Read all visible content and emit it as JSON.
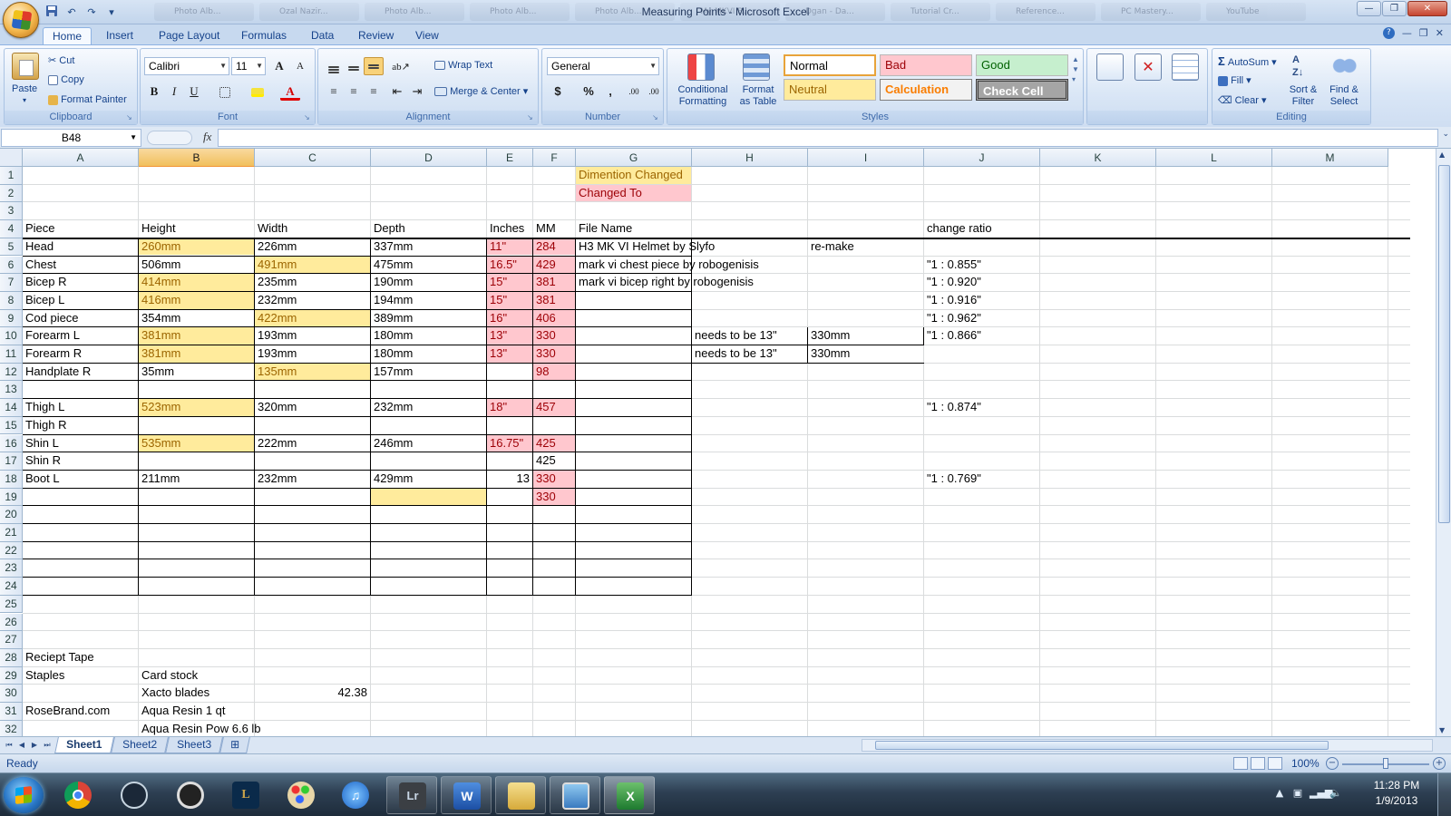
{
  "window": {
    "title": "Measuring Points - Microsoft Excel",
    "background_tabs": [
      "Photo Alb...",
      "Ozal Nazir...",
      "Photo Alb...",
      "Photo Alb...",
      "Photo Alb...",
      "My MKVI P...",
      "Dgan - Da...",
      "Tutorial Cr...",
      "Reference...",
      "PC Mastery...",
      "YouTube"
    ]
  },
  "qat": {
    "save": "save-icon",
    "undo": "undo-icon",
    "redo": "redo-icon"
  },
  "ribbon_tabs": [
    "Home",
    "Insert",
    "Page Layout",
    "Formulas",
    "Data",
    "Review",
    "View"
  ],
  "active_tab": "Home",
  "clipboard": {
    "paste": "Paste",
    "cut": "Cut",
    "copy": "Copy",
    "format_painter": "Format Painter",
    "label": "Clipboard"
  },
  "font": {
    "name": "Calibri",
    "size": "11",
    "grow": "A",
    "shrink": "A",
    "bold": "B",
    "italic": "I",
    "underline": "U",
    "label": "Font",
    "font_color": "A"
  },
  "alignment": {
    "wrap": "Wrap Text",
    "merge": "Merge & Center",
    "label": "Alignment"
  },
  "number": {
    "format": "General",
    "currency": "$",
    "percent": "%",
    "comma": ",",
    "inc_dec": ".00",
    "label": "Number"
  },
  "styles": {
    "conditional": "Conditional Formatting",
    "format_table": "Format as Table",
    "normal": "Normal",
    "bad": "Bad",
    "good": "Good",
    "neutral": "Neutral",
    "calculation": "Calculation",
    "check_cell": "Check Cell",
    "label": "Styles"
  },
  "cells": {
    "G1": "Dimention Changed",
    "G2": "Changed To",
    "A4": "Piece",
    "B4": "Height",
    "C4": "Width",
    "D4": "Depth",
    "E4": "Inches",
    "F4": "MM",
    "G4": "File Name",
    "J4": "change ratio",
    "A5": "Head",
    "B5": "260mm",
    "C5": "226mm",
    "D5": "337mm",
    "E5": "11\"",
    "F5": "284",
    "G5": "H3 MK VI Helmet by Slyfo",
    "I5": "re-make",
    "A6": "Chest",
    "B6": "506mm",
    "C6": "491mm",
    "D6": "475mm",
    "E6": "16.5\"",
    "F6": "429",
    "G6": "mark vi chest piece by robogenisis",
    "J6": "\"1 : 0.855\"",
    "A7": "Bicep R",
    "B7": "414mm",
    "C7": "235mm",
    "D7": "190mm",
    "E7": "15\"",
    "F7": "381",
    "G7": "mark vi bicep right by robogenisis",
    "J7": "\"1 : 0.920\"",
    "A8": "Bicep L",
    "B8": "416mm",
    "C8": "232mm",
    "D8": "194mm",
    "E8": "15\"",
    "F8": "381",
    "J8": "\"1 : 0.916\"",
    "A9": "Cod piece",
    "B9": "354mm",
    "C9": "422mm",
    "D9": "389mm",
    "E9": "16\"",
    "F9": "406",
    "J9": "\"1 : 0.962\"",
    "A10": "Forearm L",
    "B10": "381mm",
    "C10": "193mm",
    "D10": "180mm",
    "E10": "13\"",
    "F10": "330",
    "H10": "needs to be 13\"",
    "I10": "330mm",
    "J10": "\"1 : 0.866\"",
    "A11": "Forearm R",
    "B11": "381mm",
    "C11": "193mm",
    "D11": "180mm",
    "E11": "13\"",
    "F11": "330",
    "H11": "needs to be 13\"",
    "I11": "330mm",
    "A12": "Handplate R",
    "B12": "35mm",
    "C12": "135mm",
    "D12": "157mm",
    "F12": "98",
    "A14": "Thigh L",
    "B14": "523mm",
    "C14": "320mm",
    "D14": "232mm",
    "E14": "18\"",
    "F14": "457",
    "J14": "\"1 : 0.874\"",
    "A15": "Thigh R",
    "A16": "Shin L",
    "B16": "535mm",
    "C16": "222mm",
    "D16": "246mm",
    "E16": "16.75\"",
    "F16": "425",
    "A17": "Shin R",
    "F17": "425",
    "A18": "Boot L",
    "B18": "211mm",
    "C18": "232mm",
    "D18": "429mm",
    "E18": "13",
    "F18": "330",
    "J18": "\"1 : 0.769\"",
    "F19": "330",
    "A28": "Reciept Tape",
    "A29": "Staples",
    "B29": "Card stock",
    "B30": "Xacto blades",
    "C30": "42.38",
    "A31": "RoseBrand.com",
    "B31": "Aqua Resin 1 qt",
    "B32": "Aqua Resin Pow 6.6 lb"
  },
  "editing": {
    "autosum": "AutoSum",
    "fill": "Fill",
    "clear": "Clear",
    "sort": "Sort & Filter",
    "find": "Find & Select",
    "label": "Editing"
  },
  "formula": {
    "name_box": "B48",
    "fx": "fx",
    "content": ""
  },
  "columns": [
    "A",
    "B",
    "C",
    "D",
    "E",
    "F",
    "G",
    "H",
    "I",
    "J",
    "K",
    "L",
    "M"
  ],
  "selected_column": "B",
  "rows": [
    "1",
    "2",
    "3",
    "4",
    "5",
    "6",
    "7",
    "8",
    "9",
    "10",
    "11",
    "12",
    "13",
    "14",
    "15",
    "16",
    "17",
    "18",
    "19",
    "20",
    "21",
    "22",
    "23",
    "24",
    "25",
    "26",
    "27",
    "28",
    "29",
    "30",
    "31",
    "32"
  ],
  "neutral_cells": [
    "G1",
    "B5",
    "C6",
    "B7",
    "B8",
    "C9",
    "B10",
    "B11",
    "C12",
    "B14",
    "B16",
    "D19"
  ],
  "bad_cells": [
    "G2",
    "E5",
    "F5",
    "E6",
    "F6",
    "E7",
    "F7",
    "E8",
    "F8",
    "E9",
    "F9",
    "E10",
    "F10",
    "E11",
    "F11",
    "F12",
    "E14",
    "F14",
    "E16",
    "F16",
    "F18",
    "F19"
  ],
  "right_aligned_cells": [
    "E18",
    "C30"
  ],
  "colors": {
    "neutral_fill": "#ffeb9c",
    "neutral_text": "#9c6500",
    "bad_fill": "#ffc7ce",
    "bad_text": "#9c0006",
    "good_fill": "#c6efce",
    "good_text": "#006100"
  },
  "sheets": [
    "Sheet1",
    "Sheet2",
    "Sheet3"
  ],
  "active_sheet": "Sheet1",
  "status": {
    "text": "Ready",
    "zoom": "100%"
  },
  "taskbar": {
    "apps": [
      "chrome-icon",
      "steam-icon",
      "obs-icon",
      "league-icon",
      "paint-icon",
      "itunes-icon",
      "lightroom-icon",
      "word-icon",
      "explorer-icon",
      "photos-icon",
      "excel-icon"
    ],
    "lightroom": "Lr",
    "time": "11:28 PM",
    "date": "1/9/2013"
  }
}
